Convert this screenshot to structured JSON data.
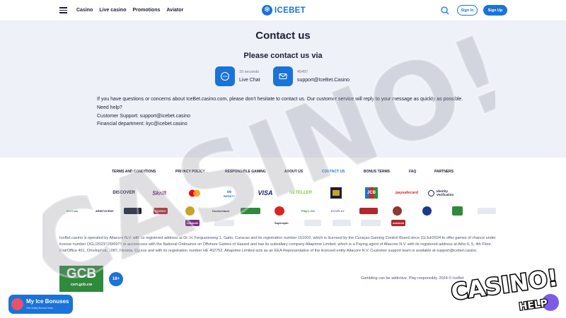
{
  "header": {
    "nav": [
      "Casino",
      "Live casino",
      "Promotions",
      "Aviator"
    ],
    "logo_glyph": "❄",
    "logo_text": "ICEBET",
    "signin_label": "Sign In",
    "signup_label": "Sign Up",
    "menu_icon": "hamburger-icon",
    "search_icon": "search-icon"
  },
  "contact": {
    "title": "Contact us",
    "subtitle": "Please contact us via",
    "channels": [
      {
        "icon": "chat-bubble-icon",
        "meta": "10 seconds",
        "label": "Live Chat"
      },
      {
        "icon": "envelope-icon",
        "meta": "45497",
        "label": "support@IceBet.Casino"
      }
    ],
    "paragraph": "If you have questions or concerns about IceBet.casino.com, please don't hesitate to contact us. Our customer service will reply to your message as quickly as possible.",
    "help": "Need help?",
    "support_line": "Customer Support: support@icebet.casino",
    "finance_line": "Financial department: kyc@icebet.casino"
  },
  "footer": {
    "links": [
      {
        "label": "TERMS AND CONDITIONS",
        "active": false
      },
      {
        "label": "PRIVACY POLICY",
        "active": false
      },
      {
        "label": "RESPONSIBLE GAMING",
        "active": false
      },
      {
        "label": "ABOUT US",
        "active": false
      },
      {
        "label": "CONTACT US",
        "active": true
      },
      {
        "label": "BONUS TERMS",
        "active": false
      },
      {
        "label": "FAQ",
        "active": false
      },
      {
        "label": "PARTNERS",
        "active": false
      }
    ],
    "payments": [
      "DISCOVER",
      "Skrill",
      "mastercard",
      "INFINITY",
      "VISA",
      "NETELLER",
      "",
      "JCB",
      "paysafecard",
      "Identity Verification"
    ],
    "providers": [
      "SlotCats",
      "ARISTOCRAT",
      "",
      "CASINO",
      "",
      "Deutschland",
      "",
      "",
      "Play'n GO",
      "EVOPLAY",
      "",
      "",
      "",
      "",
      "",
      "",
      "",
      "",
      "",
      "casinoki",
      "",
      "Superspin",
      "",
      "",
      "",
      "casinoin"
    ],
    "legal": "IceBet.casino is operated by Altacore N.V. with its registered address at Dr. H. Fergusonweg 1, Gaito, Curacao and its registration number 151002, which is licensed by the Curaçao Gaming Control Board since 01/Jul/2024 to offer games of chance under license number OGL/2023/109/0075 in accordance with the National Ordinance on Offshore Games of Hazard and has its subsidiary company Altaprime Limited, which is a Paying agent of Altacore N.V. with its registered address at Atho 6, 5, 4th Floor, Flat/Office 401, Omologites, 1087, Nicosia, Cyprus and with its registration number HE 402752. Altaprime Limited acts as an EEA Representative of the licensed entity Altacore N.V. Customer support team is available at support@icebet.casino.",
    "gcb_big": "GCB",
    "gcb_small": "cert.gcb.cw",
    "age_badge": "18+",
    "gamble_note": "Gambling can be addictive. Play responsibly. 2024 © IceBet"
  },
  "promo": {
    "title": "My Ice Bonuses",
    "subtitle": "Get Daily Bonus Now"
  },
  "watermark": {
    "text": "CASINO!",
    "sub": "HELP"
  },
  "colors": {
    "accent": "#1a73d9",
    "contact_bg": "#eef1f8",
    "text": "#1a1f36",
    "license_green": "#2f8a3b"
  }
}
